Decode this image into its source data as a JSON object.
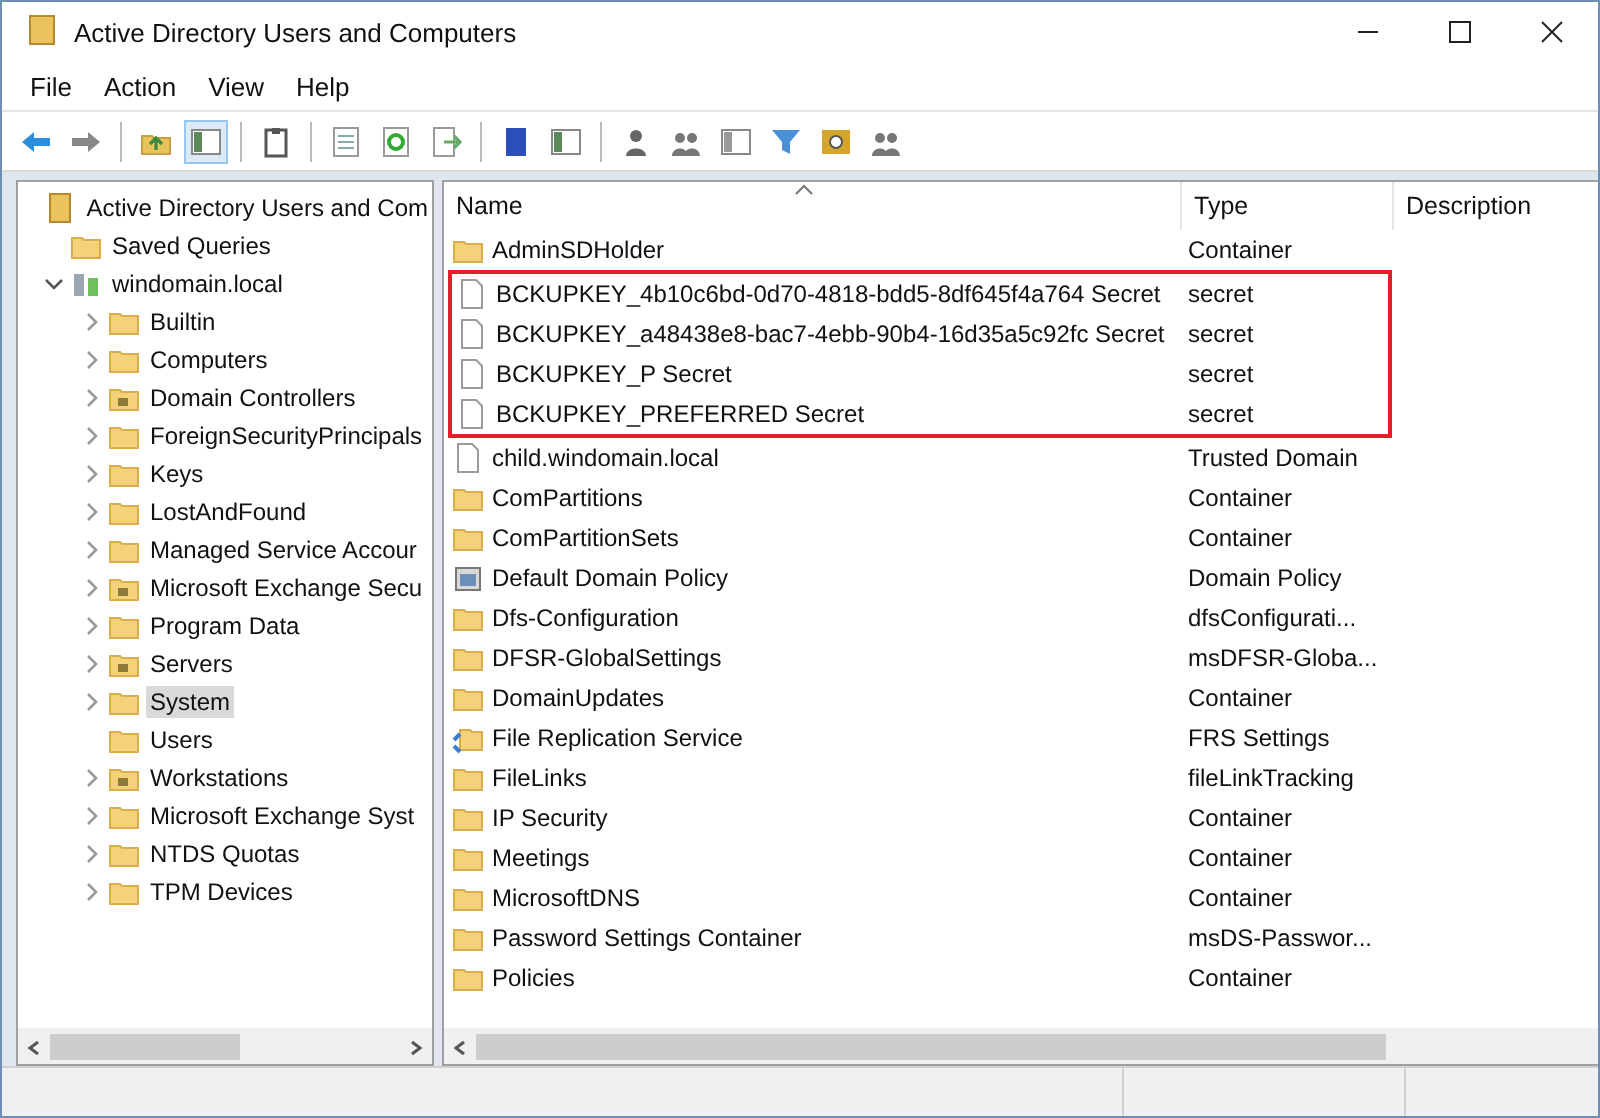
{
  "window": {
    "title": "Active Directory Users and Computers"
  },
  "menu": [
    "File",
    "Action",
    "View",
    "Help"
  ],
  "tree": [
    {
      "label": "Active Directory Users and Com",
      "kind": "root",
      "selected": false,
      "children": [
        {
          "label": "Saved Queries",
          "kind": "folder",
          "selected": false
        },
        {
          "label": "windomain.local",
          "kind": "domain",
          "expanded": true,
          "selected": false,
          "children": [
            {
              "label": "Builtin",
              "kind": "folder",
              "expanded": false,
              "selected": false
            },
            {
              "label": "Computers",
              "kind": "folder",
              "expanded": false,
              "selected": false
            },
            {
              "label": "Domain Controllers",
              "kind": "ou",
              "expanded": false,
              "selected": false
            },
            {
              "label": "ForeignSecurityPrincipals",
              "kind": "folder",
              "expanded": false,
              "selected": false
            },
            {
              "label": "Keys",
              "kind": "folder",
              "expanded": false,
              "selected": false
            },
            {
              "label": "LostAndFound",
              "kind": "folder",
              "expanded": false,
              "selected": false
            },
            {
              "label": "Managed Service Accour",
              "kind": "folder",
              "expanded": false,
              "selected": false
            },
            {
              "label": "Microsoft Exchange Secu",
              "kind": "ou",
              "expanded": false,
              "selected": false
            },
            {
              "label": "Program Data",
              "kind": "folder",
              "expanded": false,
              "selected": false
            },
            {
              "label": "Servers",
              "kind": "ou",
              "expanded": false,
              "selected": false
            },
            {
              "label": "System",
              "kind": "folder",
              "expanded": false,
              "selected": true
            },
            {
              "label": "Users",
              "kind": "folder",
              "selected": false
            },
            {
              "label": "Workstations",
              "kind": "ou",
              "expanded": false,
              "selected": false
            },
            {
              "label": "Microsoft Exchange Syst",
              "kind": "folder",
              "expanded": false,
              "selected": false
            },
            {
              "label": "NTDS Quotas",
              "kind": "folder",
              "expanded": false,
              "selected": false
            },
            {
              "label": "TPM Devices",
              "kind": "folder",
              "expanded": false,
              "selected": false
            }
          ]
        }
      ]
    }
  ],
  "table": {
    "columns": [
      "Name",
      "Type",
      "Description"
    ],
    "rows": [
      {
        "name": "AdminSDHolder",
        "type": "Container",
        "kind": "folder",
        "highlighted": false
      },
      {
        "name": "BCKUPKEY_4b10c6bd-0d70-4818-bdd5-8df645f4a764 Secret",
        "type": "secret",
        "kind": "secret",
        "highlighted": true
      },
      {
        "name": "BCKUPKEY_a48438e8-bac7-4ebb-90b4-16d35a5c92fc Secret",
        "type": "secret",
        "kind": "secret",
        "highlighted": true
      },
      {
        "name": "BCKUPKEY_P Secret",
        "type": "secret",
        "kind": "secret",
        "highlighted": true
      },
      {
        "name": "BCKUPKEY_PREFERRED Secret",
        "type": "secret",
        "kind": "secret",
        "highlighted": true
      },
      {
        "name": "child.windomain.local",
        "type": "Trusted Domain",
        "kind": "secret",
        "highlighted": false
      },
      {
        "name": "ComPartitions",
        "type": "Container",
        "kind": "folder",
        "highlighted": false
      },
      {
        "name": "ComPartitionSets",
        "type": "Container",
        "kind": "folder",
        "highlighted": false
      },
      {
        "name": "Default Domain Policy",
        "type": "Domain Policy",
        "kind": "policy",
        "highlighted": false
      },
      {
        "name": "Dfs-Configuration",
        "type": "dfsConfigurati...",
        "kind": "folder",
        "highlighted": false
      },
      {
        "name": "DFSR-GlobalSettings",
        "type": "msDFSR-Globa...",
        "kind": "folder",
        "highlighted": false
      },
      {
        "name": "DomainUpdates",
        "type": "Container",
        "kind": "folder",
        "highlighted": false
      },
      {
        "name": "File Replication Service",
        "type": "FRS Settings",
        "kind": "frs",
        "highlighted": false
      },
      {
        "name": "FileLinks",
        "type": "fileLinkTracking",
        "kind": "folder",
        "highlighted": false
      },
      {
        "name": "IP Security",
        "type": "Container",
        "kind": "folder",
        "highlighted": false
      },
      {
        "name": "Meetings",
        "type": "Container",
        "kind": "folder",
        "highlighted": false
      },
      {
        "name": "MicrosoftDNS",
        "type": "Container",
        "kind": "folder",
        "highlighted": false
      },
      {
        "name": "Password Settings Container",
        "type": "msDS-Passwor...",
        "kind": "folder",
        "highlighted": false
      },
      {
        "name": "Policies",
        "type": "Container",
        "kind": "folder",
        "highlighted": false
      }
    ]
  }
}
